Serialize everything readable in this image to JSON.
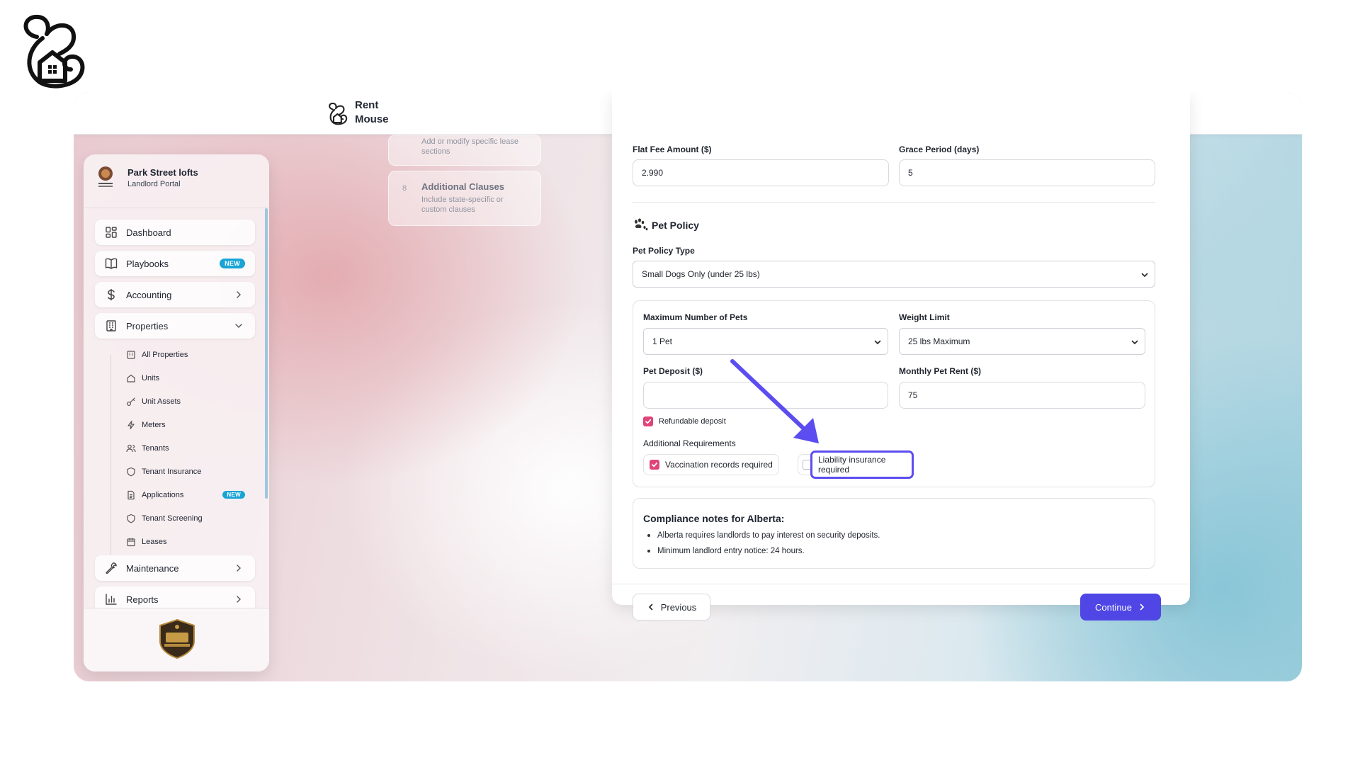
{
  "app": {
    "name": "Rent Mouse",
    "name_line1": "Rent",
    "name_line2": "Mouse"
  },
  "sidebar": {
    "property_name": "Park Street lofts",
    "portal_label": "Landlord Portal",
    "items": [
      {
        "label": "Dashboard",
        "icon": "dashboard-icon"
      },
      {
        "label": "Playbooks",
        "icon": "book-icon",
        "badge": "NEW"
      },
      {
        "label": "Accounting",
        "icon": "dollar-icon",
        "chevron": "right"
      },
      {
        "label": "Properties",
        "icon": "building-icon",
        "chevron": "down"
      },
      {
        "label": "Maintenance",
        "icon": "wrench-icon",
        "chevron": "right"
      },
      {
        "label": "Reports",
        "icon": "bar-chart-icon",
        "chevron": "right"
      }
    ],
    "sub_items": [
      {
        "label": "All Properties",
        "icon": "building-icon"
      },
      {
        "label": "Units",
        "icon": "home-icon"
      },
      {
        "label": "Unit Assets",
        "icon": "key-icon"
      },
      {
        "label": "Meters",
        "icon": "bolt-icon"
      },
      {
        "label": "Tenants",
        "icon": "users-icon"
      },
      {
        "label": "Tenant Insurance",
        "icon": "shield-icon"
      },
      {
        "label": "Applications",
        "icon": "document-icon",
        "badge": "NEW"
      },
      {
        "label": "Tenant Screening",
        "icon": "shield-icon"
      },
      {
        "label": "Leases",
        "icon": "calendar-icon"
      }
    ]
  },
  "steps": [
    {
      "number": "",
      "title": "",
      "description": "Add or modify specific lease sections"
    },
    {
      "number": "8",
      "title": "Additional Clauses",
      "description": "Include state-specific or custom clauses"
    }
  ],
  "form": {
    "flat_fee": {
      "label": "Flat Fee Amount ($)",
      "value": "2.990"
    },
    "grace_period": {
      "label": "Grace Period (days)",
      "value": "5"
    },
    "pet_policy_heading": "Pet Policy",
    "pet_policy_type": {
      "label": "Pet Policy Type",
      "value": "Small Dogs Only (under 25 lbs)"
    },
    "max_pets": {
      "label": "Maximum Number of Pets",
      "value": "1 Pet"
    },
    "weight_limit": {
      "label": "Weight Limit",
      "value": "25 lbs Maximum"
    },
    "pet_deposit": {
      "label": "Pet Deposit ($)",
      "value": ""
    },
    "monthly_pet_rent": {
      "label": "Monthly Pet Rent ($)",
      "value": "75"
    },
    "refundable_deposit": {
      "label": "Refundable deposit",
      "checked": true
    },
    "additional_requirements_label": "Additional Requirements",
    "vaccination": {
      "label": "Vaccination records required",
      "checked": true
    },
    "liability": {
      "label": "Liability insurance required",
      "checked": false
    },
    "compliance": {
      "title": "Compliance notes for Alberta:",
      "notes": [
        "Alberta requires landlords to pay interest on security deposits.",
        "Minimum landlord entry notice: 24 hours."
      ]
    },
    "previous_label": "Previous",
    "continue_label": "Continue"
  },
  "colors": {
    "accent": "#4f46e5",
    "highlight": "#5b4df0",
    "checkbox": "#e0457a",
    "badge": "#19a4d6"
  }
}
